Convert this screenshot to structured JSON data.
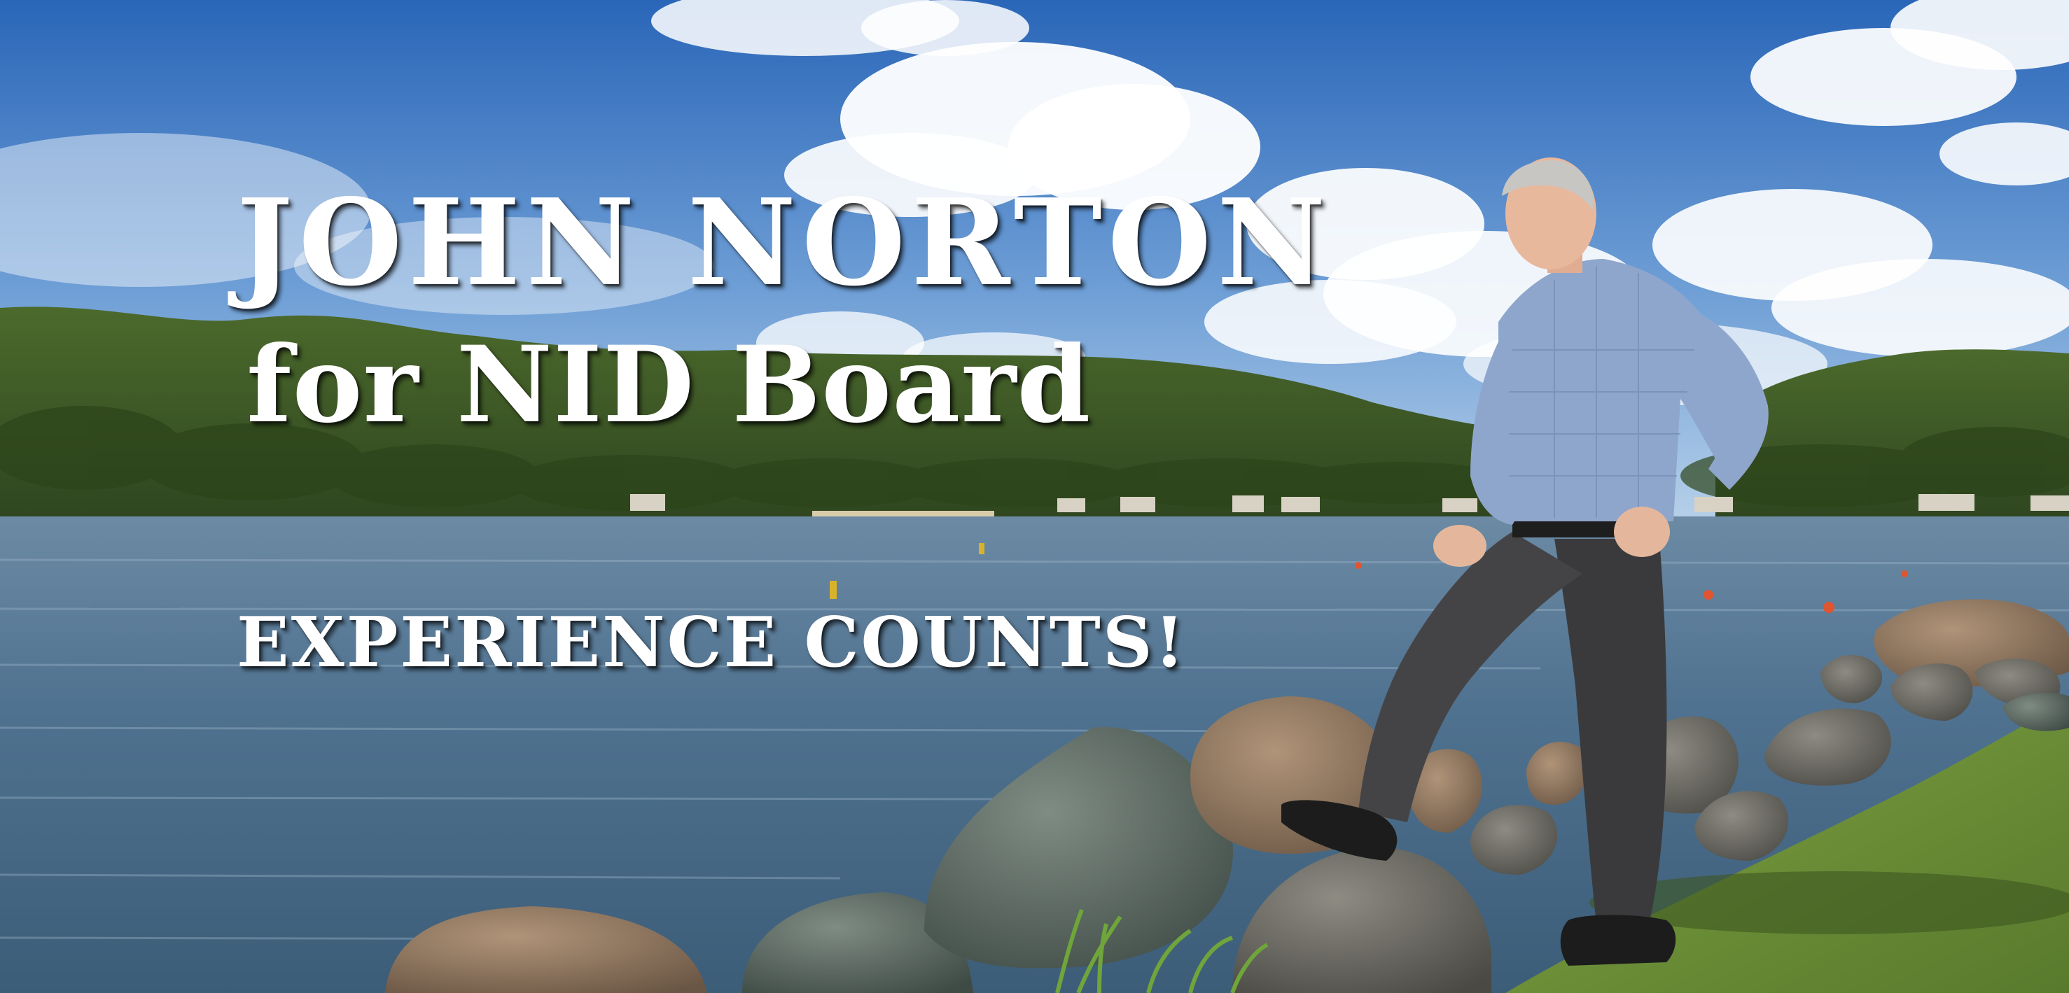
{
  "banner": {
    "name_line": "JOHN NORTON",
    "office_line": "for NID Board",
    "slogan": "EXPERIENCE COUNTS!"
  },
  "colors": {
    "sky_top": "#2f6fc0",
    "sky_horizon": "#a9c8e8",
    "cloud": "#ffffff",
    "hills": "#3f5a25",
    "lake": "#4a6f8e",
    "grass": "#6e8f3a",
    "rock": "#6b6a62",
    "shirt": "#8fa6cc",
    "trousers": "#3a3a3c",
    "headline_text": "#ffffff"
  },
  "scene": {
    "description_icons": [
      "lake-photo",
      "candidate-figure",
      "rocks",
      "clouds",
      "hills"
    ]
  }
}
